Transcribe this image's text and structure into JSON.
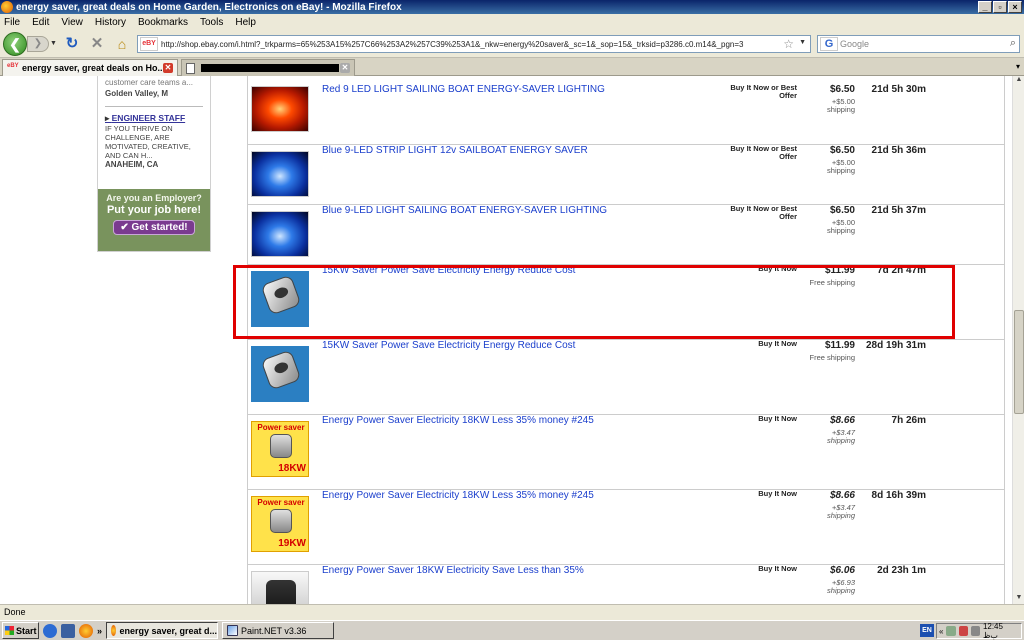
{
  "window": {
    "title": "energy saver, great deals on Home Garden, Electronics on eBay! - Mozilla Firefox",
    "controls": [
      "_",
      "▫",
      "×"
    ]
  },
  "menu": [
    "File",
    "Edit",
    "View",
    "History",
    "Bookmarks",
    "Tools",
    "Help"
  ],
  "nav": {
    "url": "http://shop.ebay.com/i.html?_trkparms=65%253A15%257C66%253A2%257C39%253A1&_nkw=energy%20saver&_sc=1&_sop=15&_trksid=p3286.c0.m14&_pgn=3",
    "site_icon_text": "eBY",
    "search_placeholder": "Google",
    "search_engine_glyph": "G"
  },
  "tabs": [
    {
      "label": "energy saver, great deals on Ho...",
      "active": true
    },
    {
      "label": "",
      "active": false
    }
  ],
  "sidebar": {
    "snippet": "customer care teams a...",
    "location1": "Golden Valley, M",
    "job_link": "ENGINEER STAFF",
    "job_desc": "IF YOU THRIVE ON CHALLENGE, ARE MOTIVATED, CREATIVE, AND CAN H...",
    "location2": "ANAHEIM, CA",
    "employer_line1": "Are you an Employer?",
    "employer_line2": "Put your job here!",
    "employer_button": "✔ Get started!"
  },
  "listings": [
    {
      "title": "Red 9 LED LIGHT SAILING BOAT ENERGY-SAVER LIGHTING",
      "format": "Buy It Now or Best Offer",
      "price": "$6.50",
      "shipping": "+$5.00 shipping",
      "time": "21d 5h 30m",
      "thumb": "led-red"
    },
    {
      "title": "Blue 9-LED STRIP LIGHT 12v SAILBOAT ENERGY SAVER",
      "format": "Buy It Now or Best Offer",
      "price": "$6.50",
      "shipping": "+$5.00 shipping",
      "time": "21d 5h 36m",
      "thumb": "led-blue"
    },
    {
      "title": "Blue 9-LED LIGHT SAILING BOAT ENERGY-SAVER LIGHTING",
      "format": "Buy It Now or Best Offer",
      "price": "$6.50",
      "shipping": "+$5.00 shipping",
      "time": "21d 5h 37m",
      "thumb": "led-blue"
    },
    {
      "title": "15KW Saver Power Save Electricity Energy Reduce Cost",
      "format": "Buy It Now",
      "price": "$11.99",
      "shipping": "Free shipping",
      "time": "7d 2h 47m",
      "thumb": "saver",
      "highlighted": true
    },
    {
      "title": "15KW Saver Power Save Electricity Energy Reduce Cost",
      "format": "Buy It Now",
      "price": "$11.99",
      "shipping": "Free shipping",
      "time": "28d 19h 31m",
      "thumb": "saver"
    },
    {
      "title": "Energy Power Saver Electricity 18KW Less 35% money #245",
      "format": "Buy It Now",
      "price": "$8.66",
      "shipping": "+$3.47 shipping",
      "time": "7h 26m",
      "thumb": "yellow",
      "thumb_text": "Power saver",
      "thumb_kw": "18KW"
    },
    {
      "title": "Energy Power Saver Electricity 18KW Less 35% money #245",
      "format": "Buy It Now",
      "price": "$8.66",
      "shipping": "+$3.47 shipping",
      "time": "8d 16h 39m",
      "thumb": "yellow",
      "thumb_text": "Power saver",
      "thumb_kw": "19KW"
    },
    {
      "title": "Energy Power Saver 18KW Electricity Save Less than 35%",
      "format": "Buy It Now",
      "price": "$6.06",
      "shipping": "+$6.93 shipping",
      "time": "2d 23h 1m",
      "thumb": "dark"
    }
  ],
  "status": "Done",
  "taskbar": {
    "start": "Start",
    "tasks": [
      {
        "label": "energy saver, great d...",
        "active": true
      },
      {
        "label": "Paint.NET v3.36",
        "active": false
      }
    ],
    "lang": "EN",
    "clock": "12:45 ﺏﻅ"
  }
}
